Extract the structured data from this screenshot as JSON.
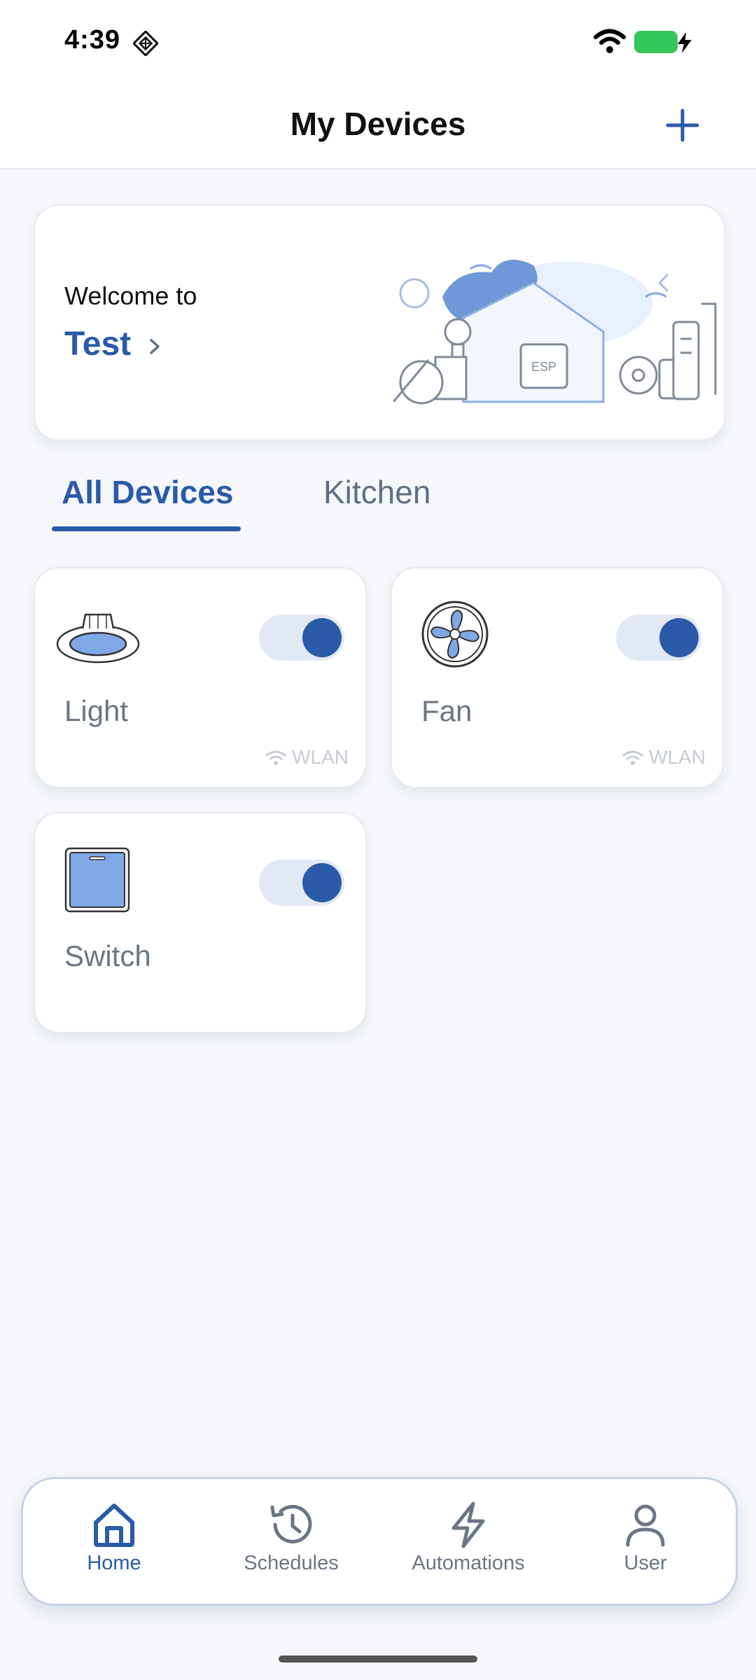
{
  "status_bar": {
    "time": "4:39",
    "battery_color": "#34c759"
  },
  "header": {
    "title": "My Devices",
    "add_icon": "plus-icon"
  },
  "welcome": {
    "label": "Welcome to",
    "home_name": "Test",
    "chevron_icon": "chevron-right-icon",
    "illustration": "smart-home-illustration"
  },
  "tabs": [
    {
      "label": "All Devices",
      "selected": true
    },
    {
      "label": "Kitchen",
      "selected": false
    }
  ],
  "devices": [
    {
      "name": "Light",
      "icon": "ceiling-light-icon",
      "on": true,
      "connection": "WLAN"
    },
    {
      "name": "Fan",
      "icon": "fan-icon",
      "on": true,
      "connection": "WLAN"
    },
    {
      "name": "Switch",
      "icon": "switch-icon",
      "on": true,
      "connection": ""
    }
  ],
  "nav": [
    {
      "label": "Home",
      "icon": "home-icon",
      "active": true
    },
    {
      "label": "Schedules",
      "icon": "history-icon",
      "active": false
    },
    {
      "label": "Automations",
      "icon": "lightning-icon",
      "active": false
    },
    {
      "label": "User",
      "icon": "user-icon",
      "active": false
    }
  ],
  "colors": {
    "accent": "#2b5aa8",
    "background": "#f5f7fa",
    "toggle_track": "#e3e9f4"
  }
}
